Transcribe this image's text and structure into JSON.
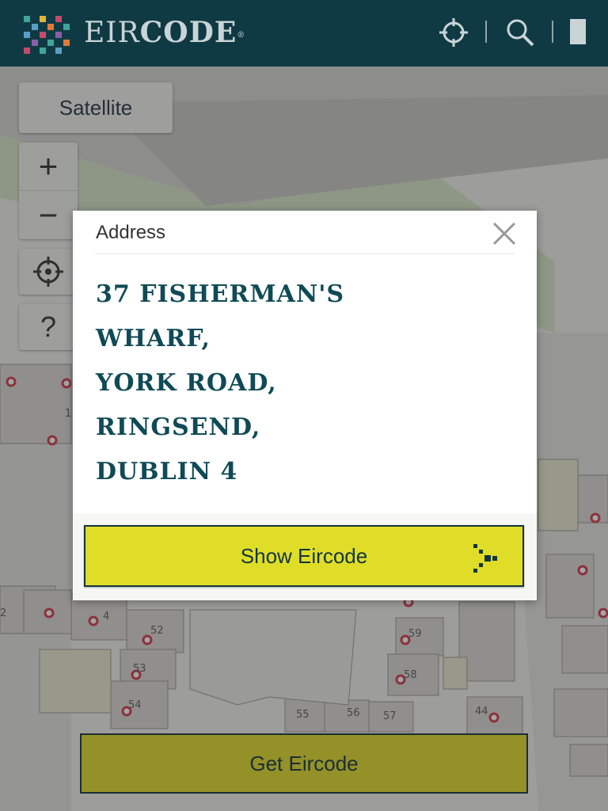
{
  "header": {
    "brand_eir": "EIR",
    "brand_code": "CODE",
    "brand_mark": "®",
    "logo_icon": "eircode-logo-icon",
    "icons": [
      "locate-crosshair-icon",
      "search-icon",
      "menu-bar-icon"
    ]
  },
  "map": {
    "satellite_label": "Satellite",
    "zoom_in_label": "+",
    "zoom_out_label": "−",
    "help_label": "?",
    "parcels": [
      "52",
      "53",
      "54",
      "55",
      "56",
      "57",
      "58",
      "59",
      "44",
      "4",
      "2",
      "1"
    ]
  },
  "modal": {
    "title": "Address",
    "address_lines": [
      "37 FISHERMAN'S",
      "WHARF,",
      "YORK ROAD,",
      "RINGSEND,",
      "DUBLIN 4"
    ],
    "show_button_label": "Show Eircode"
  },
  "footer": {
    "get_button_label": "Get Eircode"
  },
  "colors": {
    "header_bg": "#0f3a44",
    "accent_yellow": "#e0dd28",
    "text_teal": "#0f4a56"
  }
}
